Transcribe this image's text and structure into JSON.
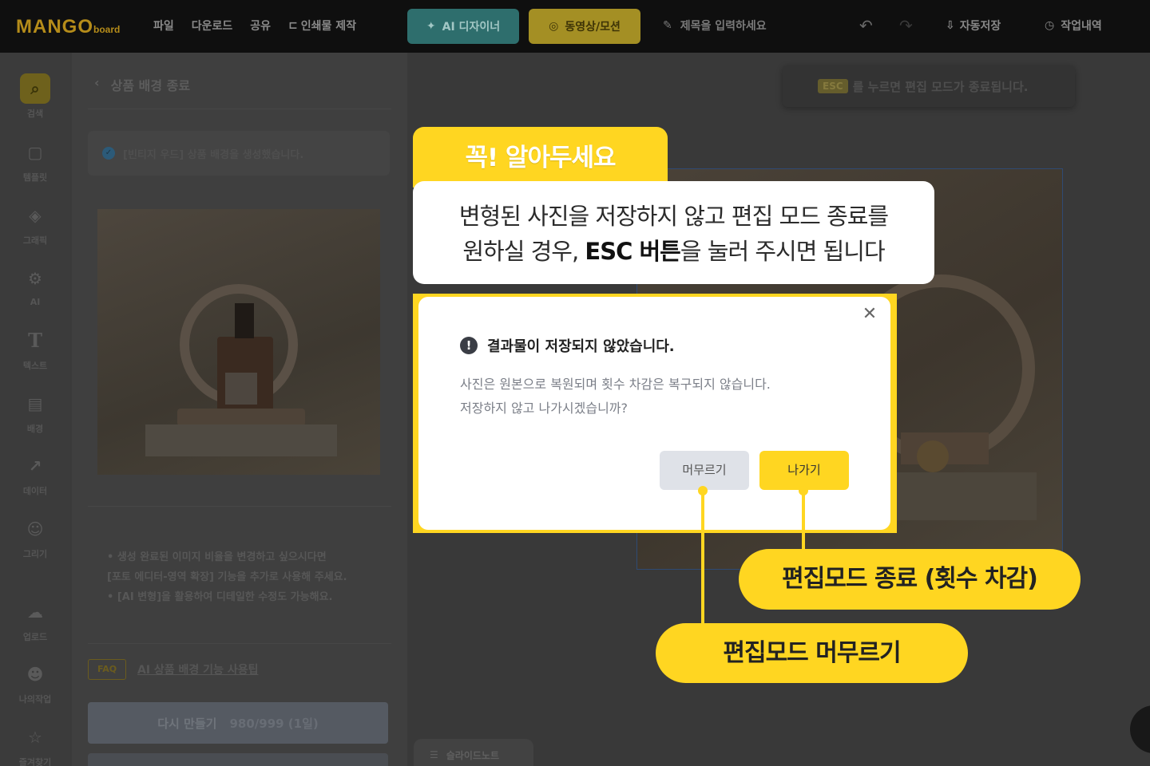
{
  "topbar": {
    "logo": "MANGO",
    "logo_sub": "board",
    "menu": [
      "파일",
      "다운로드",
      "공유"
    ],
    "print_label": "인쇄물 제작",
    "ai_designer": "AI 디자이너",
    "video_motion": "동영상/모션",
    "title_placeholder": "제목을 입력하세요",
    "autosave": "자동저장",
    "history": "작업내역"
  },
  "leftnav": {
    "items": [
      {
        "label": "검색",
        "icon": "search-icon"
      },
      {
        "label": "템플릿",
        "icon": "template-icon"
      },
      {
        "label": "그래픽",
        "icon": "graphic-icon"
      },
      {
        "label": "AI",
        "icon": "ai-icon"
      },
      {
        "label": "텍스트",
        "icon": "text-icon"
      },
      {
        "label": "배경",
        "icon": "background-icon"
      },
      {
        "label": "데이터",
        "icon": "chart-icon"
      },
      {
        "label": "그리기",
        "icon": "draw-icon"
      },
      {
        "label": "업로드",
        "icon": "upload-icon"
      },
      {
        "label": "나의작업",
        "icon": "my-work-icon"
      },
      {
        "label": "즐겨찾기",
        "icon": "favorite-icon"
      }
    ]
  },
  "panel": {
    "title": "상품 배경 종료",
    "notice": "[빈티지 우드] 상품 배경을 생성했습니다.",
    "tips": [
      "• 생성 완료된 이미지 비율을 변경하고 싶으시다면",
      "[포토 에디터-영역 확장] 기능을 추가로 사용해 주세요.",
      "• [AI 변형]을 활용하여 디테일한 수정도 가능해요."
    ],
    "faq_badge": "FAQ",
    "faq_link": "AI 상품 배경 기능 사용팁",
    "regen_label": "다시 만들기",
    "regen_count": "980/999 (1일)"
  },
  "canvas": {
    "esc_key": "ESC",
    "esc_text": "를 누르면 편집 모드가 종료됩니다.",
    "slide_note": "슬라이드노트"
  },
  "callout": {
    "tab": "꼭! 알아두세요",
    "line1": "변형된 사진을 저장하지 않고 편집 모드 종료를",
    "line2_pre": "원하실 경우, ",
    "line2_bold": "ESC 버튼",
    "line2_post": "을 눌러 주시면 됩니다",
    "pill_exit": "편집모드 종료 (횟수 차감)",
    "pill_stay": "편집모드 머무르기"
  },
  "dialog": {
    "title": "결과물이 저장되지 않았습니다.",
    "body1": "사진은 원본으로 복원되며 횟수 차감은 복구되지 않습니다.",
    "body2": "저장하지 않고 나가시겠습니까?",
    "stay": "머무르기",
    "exit": "나가기"
  }
}
